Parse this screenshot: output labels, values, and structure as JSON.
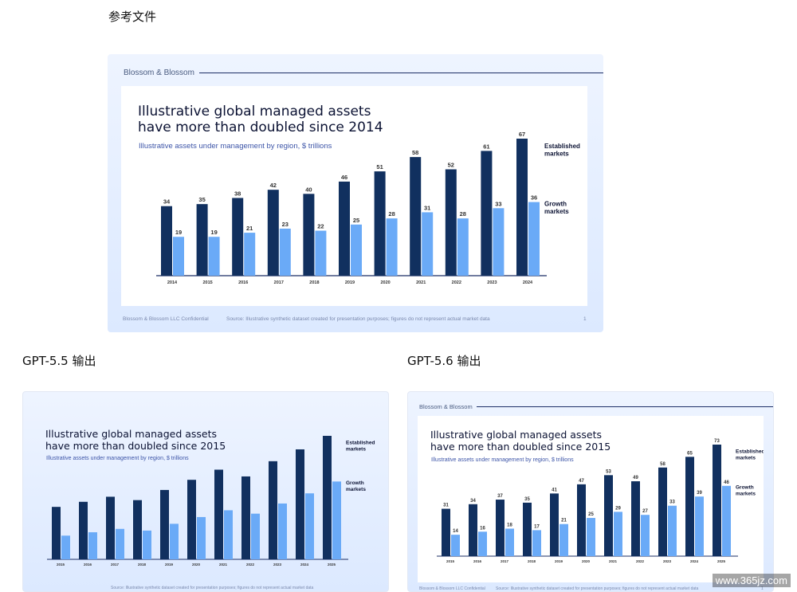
{
  "captions": {
    "reference": "参考文件",
    "gpt55": "GPT-5.5 输出",
    "gpt56": "GPT-5.6 输出"
  },
  "colors": {
    "established": "#11305f",
    "growth": "#6aaaf7",
    "axis": "#1c2f66"
  },
  "slides": {
    "reference": {
      "brand": "Blossom & Blossom",
      "title_line1": "Illustrative global managed assets",
      "title_line2": "have more than doubled since 2014",
      "subtitle": "Illustrative assets under management by region, $ trillions",
      "footer_left": "Blossom & Blossom LLC Confidential",
      "footer_source": "Source: Illustrative synthetic dataset created for presentation purposes; figures do not represent actual market data",
      "page_number": "1"
    },
    "gpt55": {
      "title_line1": "Illustrative global managed assets",
      "title_line2": "have more than doubled since 2015",
      "subtitle": "Illustrative assets under management by region, $ trillions",
      "footer_source": "Source: Illustrative synthetic dataset created for presentation purposes; figures do not represent actual market data"
    },
    "gpt56": {
      "brand": "Blossom & Blossom",
      "title_line1": "Illustrative global managed assets",
      "title_line2": "have more than doubled since 2015",
      "subtitle": "Illustrative assets under management by region, $ trillions",
      "footer_left": "Blossom & Blossom LLC Confidential",
      "footer_source": "Source: Illustrative synthetic dataset created for presentation purposes; figures do not represent actual market data",
      "page_number": "1"
    }
  },
  "watermark": "www.365jz.com",
  "chart_data": [
    {
      "id": "reference",
      "type": "bar",
      "categories": [
        "2014",
        "2015",
        "2016",
        "2017",
        "2018",
        "2019",
        "2020",
        "2021",
        "2022",
        "2023",
        "2024"
      ],
      "series": [
        {
          "name": "Established markets",
          "values": [
            34,
            35,
            38,
            42,
            40,
            46,
            51,
            58,
            52,
            61,
            67
          ]
        },
        {
          "name": "Growth markets",
          "values": [
            19,
            19,
            21,
            23,
            22,
            25,
            28,
            31,
            28,
            33,
            36
          ]
        }
      ],
      "legend_labels": [
        [
          "Established",
          "markets"
        ],
        [
          "Growth",
          "markets"
        ]
      ],
      "show_values": true,
      "ylim": [
        0,
        67
      ]
    },
    {
      "id": "gpt55",
      "type": "bar",
      "categories": [
        "2015",
        "2016",
        "2017",
        "2018",
        "2019",
        "2020",
        "2021",
        "2022",
        "2023",
        "2024",
        "2025"
      ],
      "series": [
        {
          "name": "Established markets",
          "values": [
            31,
            34,
            37,
            35,
            41,
            47,
            53,
            49,
            58,
            65,
            73
          ]
        },
        {
          "name": "Growth markets",
          "values": [
            14,
            16,
            18,
            17,
            21,
            25,
            29,
            27,
            33,
            39,
            46
          ]
        }
      ],
      "legend_labels": [
        [
          "Established",
          "markets"
        ],
        [
          "Growth",
          "markets"
        ]
      ],
      "show_values": false,
      "ylim": [
        0,
        73
      ]
    },
    {
      "id": "gpt56",
      "type": "bar",
      "categories": [
        "2015",
        "2016",
        "2017",
        "2018",
        "2019",
        "2020",
        "2021",
        "2022",
        "2023",
        "2024",
        "2025"
      ],
      "series": [
        {
          "name": "Established markets",
          "values": [
            31,
            34,
            37,
            35,
            41,
            47,
            53,
            49,
            58,
            65,
            73
          ]
        },
        {
          "name": "Growth markets",
          "values": [
            14,
            16,
            18,
            17,
            21,
            25,
            29,
            27,
            33,
            39,
            46
          ]
        }
      ],
      "legend_labels": [
        [
          "Established",
          "markets"
        ],
        [
          "Growth",
          "markets"
        ]
      ],
      "show_values": true,
      "ylim": [
        0,
        73
      ]
    }
  ]
}
